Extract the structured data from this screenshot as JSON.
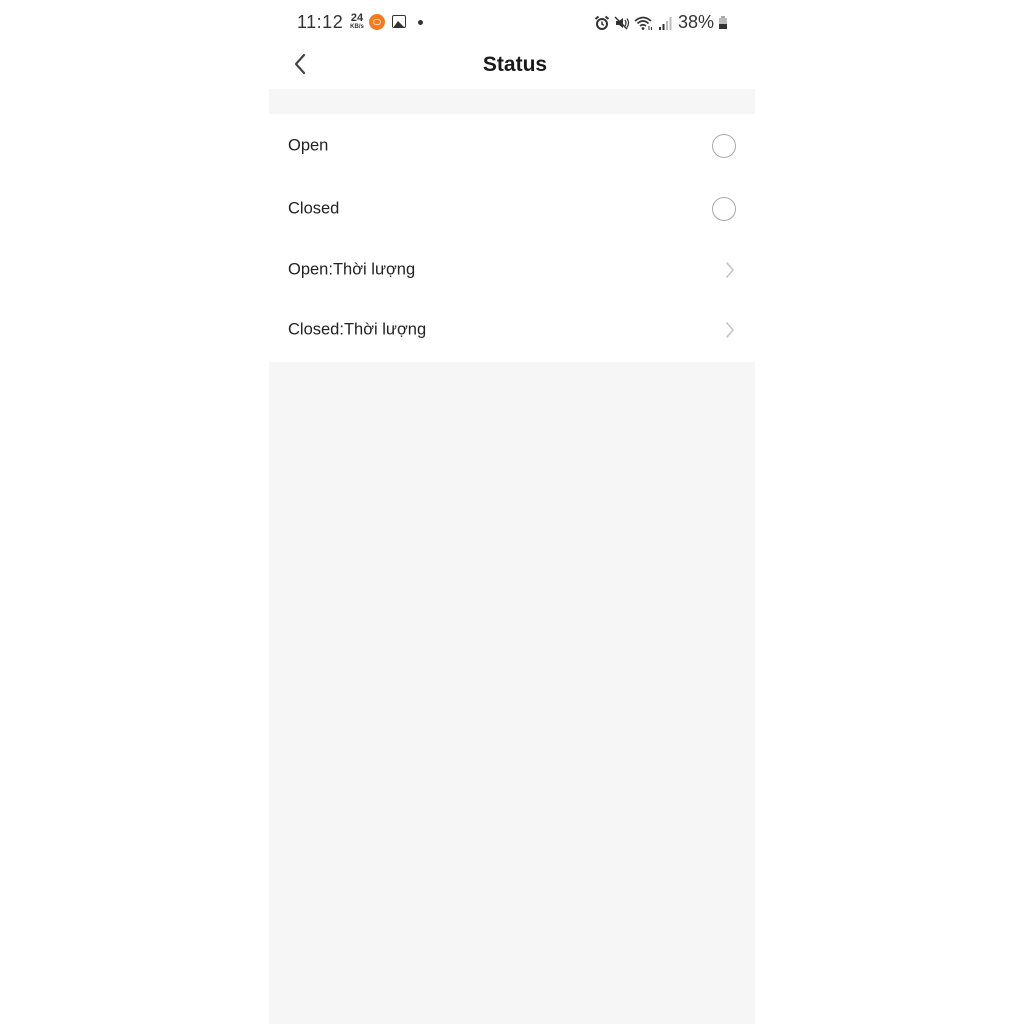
{
  "status_bar": {
    "time": "11:12",
    "net_speed_value": "24",
    "net_speed_unit": "KB/s",
    "notification_icons": [
      "app-notification-icon",
      "gallery-icon",
      "more-notifications-dot"
    ],
    "system_icons": [
      "alarm-icon",
      "mute-icon",
      "wifi-icon",
      "signal-icon"
    ],
    "battery_percent": "38%"
  },
  "header": {
    "back_icon": "chevron-left-icon",
    "title": "Status"
  },
  "options": [
    {
      "label": "Open",
      "type": "radio",
      "selected": false
    },
    {
      "label": "Closed",
      "type": "radio",
      "selected": false
    },
    {
      "label": "Open:Thời lượng",
      "type": "navigation"
    },
    {
      "label": "Closed:Thời lượng",
      "type": "navigation"
    }
  ],
  "colors": {
    "background": "#ffffff",
    "section_background": "#f6f6f6",
    "text_primary": "#222222",
    "radio_border": "#a9a9a9",
    "chevron": "#c4c4c4",
    "app_icon_accent": "#f47b20"
  }
}
